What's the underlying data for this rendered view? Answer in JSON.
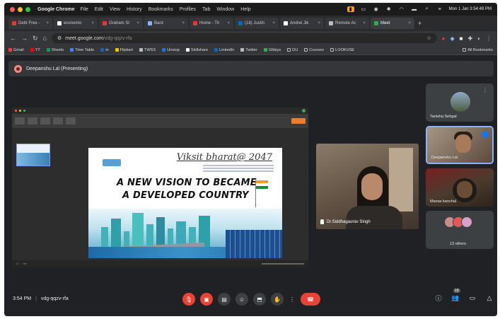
{
  "menubar": {
    "app_name": "Google Chrome",
    "items": [
      "File",
      "Edit",
      "View",
      "History",
      "Bookmarks",
      "Profiles",
      "Tab",
      "Window",
      "Help"
    ],
    "clock": "Mon 1 Jan  3:54:49 PM"
  },
  "tabs": [
    {
      "label": "Debt Free -",
      "fav_color": "#e53935"
    },
    {
      "label": "economic",
      "fav_color": "#ffffff"
    },
    {
      "label": "Graham St",
      "fav_color": "#e53935"
    },
    {
      "label": "Bard",
      "fav_color": "#8ab4f8"
    },
    {
      "label": "Home - Th",
      "fav_color": "#e53935"
    },
    {
      "label": "(18) Justin",
      "fav_color": "#0a66c2"
    },
    {
      "label": "Andrei Jik",
      "fav_color": "#ffffff"
    },
    {
      "label": "Remote Ac",
      "fav_color": "#bbbbbb"
    },
    {
      "label": "Meet",
      "fav_color": "#34a853",
      "active": true
    }
  ],
  "address": {
    "url_host": "meet.google.com",
    "url_path": "/vdg-qqzv-rfa"
  },
  "bookmarks": [
    {
      "label": "Gmail",
      "color": "#ea4335"
    },
    {
      "label": "YT",
      "color": "#ff0000"
    },
    {
      "label": "Sheets",
      "color": "#0f9d58"
    },
    {
      "label": "Time Table",
      "color": "#4285f4"
    },
    {
      "label": "in",
      "color": "#0a66c2"
    },
    {
      "label": "Flipkart",
      "color": "#f9c200"
    },
    {
      "label": "TWSS",
      "color": "#bbbbbb"
    },
    {
      "label": "Unstop",
      "color": "#1a73e8"
    },
    {
      "label": "Skillshare",
      "color": "#ffffff"
    },
    {
      "label": "LinkedIn",
      "color": "#0a66c2"
    },
    {
      "label": "Twitter",
      "color": "#bbbbbb"
    },
    {
      "label": "Gfdsys",
      "color": "#34a853"
    },
    {
      "label": "DU",
      "color": "#bbbbbb"
    },
    {
      "label": "Courses",
      "color": "#bbbbbb"
    },
    {
      "label": "LOOKUSE",
      "color": "#bbbbbb"
    }
  ],
  "all_bookmarks": "All Bookmarks",
  "presenter": {
    "label": "Deepanshu Lal (Presenting)"
  },
  "slide": {
    "tagline": "Viksit bharat@ 2047",
    "heading_line1": "A NEW VISION TO BECAME",
    "heading_line2": "A DEVELOPED COUNTRY"
  },
  "main_tile": {
    "name": "Dr.Siddhagaurav Singh"
  },
  "side_tiles": [
    {
      "name": "Tanishq Sehgal"
    },
    {
      "name": "Deepanshu Lal"
    },
    {
      "name": "Manas kanchal"
    },
    {
      "name": "13 others"
    }
  ],
  "footer": {
    "time": "3:54 PM",
    "meeting_code": "vdg-qqzv-rfa"
  },
  "participants_count": "18"
}
